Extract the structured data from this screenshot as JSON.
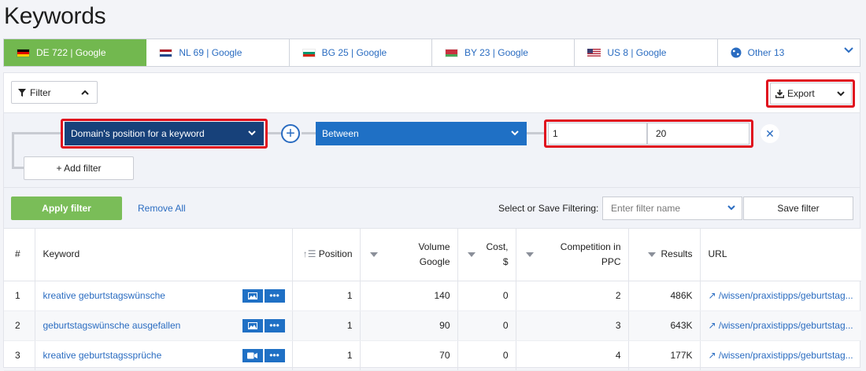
{
  "page": {
    "title": "Keywords"
  },
  "tabs": [
    {
      "label": "DE 722 | Google",
      "flag": "de",
      "active": true
    },
    {
      "label": "NL 69 | Google",
      "flag": "nl",
      "active": false
    },
    {
      "label": "BG 25 | Google",
      "flag": "bg",
      "active": false
    },
    {
      "label": "BY 23 | Google",
      "flag": "by",
      "active": false
    },
    {
      "label": "US 8 | Google",
      "flag": "us",
      "active": false
    },
    {
      "label": "Other 13",
      "flag": "globe",
      "active": false
    }
  ],
  "toolbar": {
    "filter_label": "Filter",
    "export_label": "Export"
  },
  "filter": {
    "field_label": "Domain's position for a keyword",
    "operator_label": "Between",
    "range_from": "1",
    "range_to": "20",
    "add_filter_label": "+ Add filter"
  },
  "actions": {
    "apply_label": "Apply filter",
    "remove_all_label": "Remove All",
    "save_prompt": "Select or Save Filtering:",
    "filter_name_placeholder": "Enter filter name",
    "save_filter_label": "Save filter"
  },
  "table": {
    "headers": {
      "num": "#",
      "keyword": "Keyword",
      "position": "Position",
      "volume_1": "Volume",
      "volume_2": "Google",
      "cost_1": "Cost,",
      "cost_2": "$",
      "competition_1": "Competition in",
      "competition_2": "PPC",
      "results": "Results",
      "url": "URL"
    },
    "rows": [
      {
        "num": "1",
        "keyword": "kreative geburtstagswünsche",
        "icon": "image",
        "position": "1",
        "volume": "140",
        "cost": "0",
        "competition": "2",
        "results": "486K",
        "url": "/wissen/praxistipps/geburtstag..."
      },
      {
        "num": "2",
        "keyword": "geburtstagswünsche ausgefallen",
        "icon": "image",
        "position": "1",
        "volume": "90",
        "cost": "0",
        "competition": "3",
        "results": "643K",
        "url": "/wissen/praxistipps/geburtstag..."
      },
      {
        "num": "3",
        "keyword": "kreative geburtstagssprüche",
        "icon": "video",
        "position": "1",
        "volume": "70",
        "cost": "0",
        "competition": "4",
        "results": "177K",
        "url": "/wissen/praxistipps/geburtstag..."
      }
    ]
  },
  "colors": {
    "accent_green": "#72b84f",
    "link_blue": "#2a6cc1",
    "navy": "#17417a",
    "highlight_red": "#e0101e"
  }
}
